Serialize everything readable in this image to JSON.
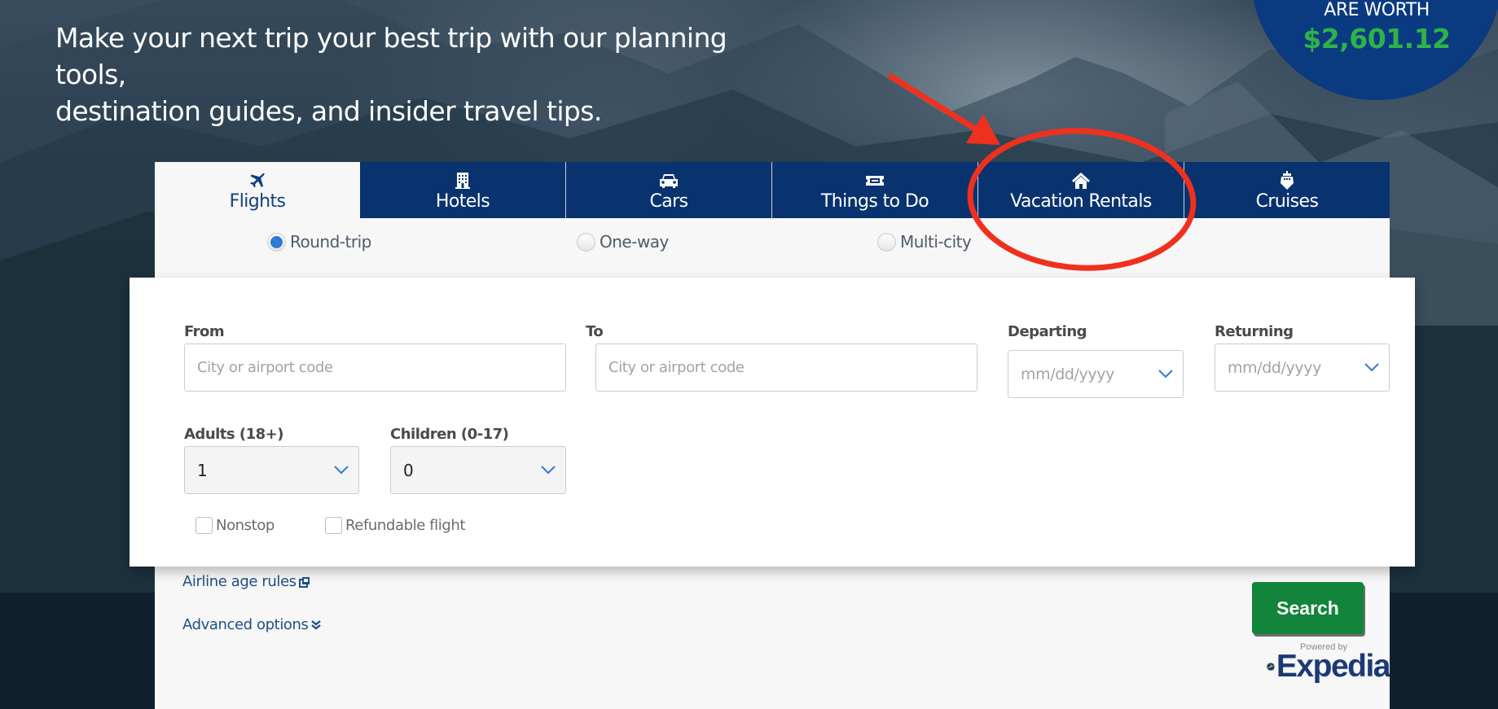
{
  "hero": {
    "headline_line1": "Make your next trip your best trip with our planning tools,",
    "headline_line2": "destination guides, and insider travel tips."
  },
  "badge": {
    "label": "ARE WORTH",
    "value": "$2,601.12",
    "background_color": "#0a3a80",
    "value_color": "#2db34a"
  },
  "tabs": [
    {
      "label": "Flights",
      "icon": "airplane-icon",
      "active": true
    },
    {
      "label": "Hotels",
      "icon": "building-icon",
      "active": false
    },
    {
      "label": "Cars",
      "icon": "car-icon",
      "active": false
    },
    {
      "label": "Things to Do",
      "icon": "ticket-icon",
      "active": false
    },
    {
      "label": "Vacation Rentals",
      "icon": "house-icon",
      "active": false
    },
    {
      "label": "Cruises",
      "icon": "ship-icon",
      "active": false
    }
  ],
  "trip_types": [
    {
      "label": "Round-trip",
      "selected": true
    },
    {
      "label": "One-way",
      "selected": false
    },
    {
      "label": "Multi-city",
      "selected": false
    }
  ],
  "form": {
    "from": {
      "label": "From",
      "placeholder": "City or airport code",
      "value": ""
    },
    "to": {
      "label": "To",
      "placeholder": "City or airport code",
      "value": ""
    },
    "departing": {
      "label": "Departing",
      "placeholder": "mm/dd/yyyy"
    },
    "returning": {
      "label": "Returning",
      "placeholder": "mm/dd/yyyy"
    },
    "adults": {
      "label": "Adults (18+)",
      "value": "1"
    },
    "children": {
      "label": "Children (0-17)",
      "value": "0"
    },
    "nonstop": {
      "label": "Nonstop",
      "checked": false
    },
    "refundable": {
      "label": "Refundable flight",
      "checked": false
    }
  },
  "links": {
    "airline_age_rules": "Airline age rules",
    "advanced_options": "Advanced options"
  },
  "search_button": {
    "label": "Search",
    "color": "#12843b"
  },
  "powered_by": {
    "label": "Powered by",
    "brand": "Expedia"
  },
  "colors": {
    "tab_bg": "#08336f",
    "accent_blue": "#2f7bd3",
    "annotation_red": "#f0301e"
  },
  "annotation": {
    "type": "red-arrow-and-circle",
    "target": "Vacation Rentals"
  }
}
